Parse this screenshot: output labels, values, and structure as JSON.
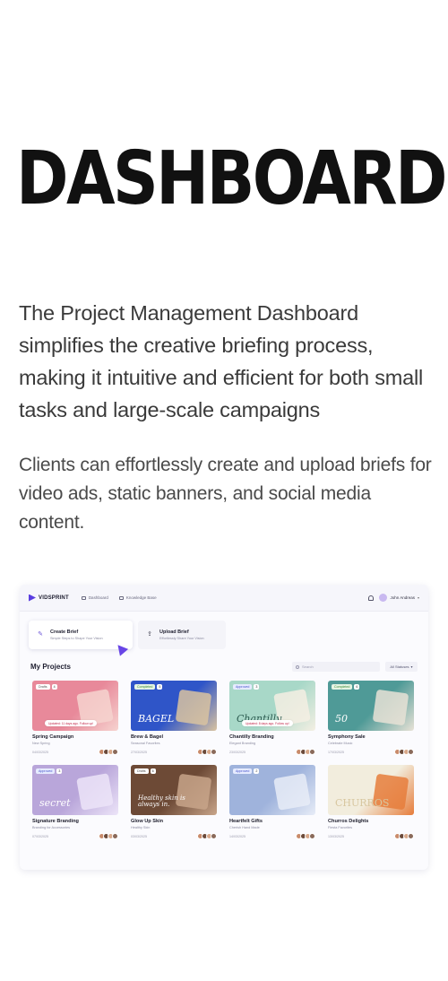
{
  "hero": {
    "title": "DASHBOARD",
    "intro": "The Project Management Dashboard simplifies the creative briefing process, making it intuitive and efficient for both small tasks and large-scale campaigns",
    "sub": "Clients can effortlessly create and upload briefs for video ads, static banners, and social media content."
  },
  "app": {
    "logo": "VIDSPRINT",
    "nav": [
      "Dashboard",
      "Knowledge Base"
    ],
    "user": "John Andreas",
    "brief_cards": [
      {
        "title": "Create Brief",
        "desc": "Simple Steps to Shape Your Vision",
        "icon": "pencil-icon"
      },
      {
        "title": "Upload Brief",
        "desc": "Effortlessly Share Your Vision",
        "icon": "upload-icon"
      }
    ],
    "projects_title": "My Projects",
    "search_placeholder": "Search",
    "status_filter": "All Statuses",
    "projects": [
      {
        "status": "Drafts",
        "count": "4",
        "title": "Spring Campaign",
        "sub": "New Spring",
        "date": "04/03/2025",
        "update": "Updated: 11 days ago. Follow up!",
        "bg": "#e8899a",
        "accent": "#f6d3cf"
      },
      {
        "status": "Completed",
        "count": "5",
        "title": "Brew & Bagel",
        "sub": "Seasonal Favorites",
        "date": "27/03/2025",
        "update": "",
        "bg": "#2f55c8",
        "accent": "#d9c3a0",
        "word": "BAGEL"
      },
      {
        "status": "Approved",
        "count": "3",
        "title": "Chantilly Branding",
        "sub": "Elegant Branding",
        "date": "23/03/2025",
        "update": "Updated: 8 days ago. Follow up!",
        "bg": "#a8d8c8",
        "accent": "#f4efe3",
        "word": "Chantilly"
      },
      {
        "status": "Completed",
        "count": "6",
        "title": "Symphony Sale",
        "sub": "Celebrate Music",
        "date": "17/03/2025",
        "update": "",
        "bg": "#4f9a97",
        "accent": "#e8e2d6",
        "word": "50"
      },
      {
        "status": "Approved",
        "count": "3",
        "title": "Signature Branding",
        "sub": "Branding for Accessories",
        "date": "07/03/2025",
        "update": "",
        "bg": "#b9a6da",
        "accent": "#ece4f8",
        "word": "secret"
      },
      {
        "status": "Drafts",
        "count": "6",
        "title": "Glow Up Skin",
        "sub": "Healthy Skin",
        "date": "03/03/2025",
        "update": "",
        "bg": "#6d4a36",
        "accent": "#c8a58a",
        "word": "Healthy skin is always in."
      },
      {
        "status": "Approved",
        "count": "2",
        "title": "Heartfelt Gifts",
        "sub": "Cherish Hand Made",
        "date": "14/03/2025",
        "update": "",
        "bg": "#9fb3dc",
        "accent": "#e7ecf7"
      },
      {
        "status": "",
        "count": "",
        "title": "Churros Delights",
        "sub": "Fiesta Favorites",
        "date": "13/03/2025",
        "update": "",
        "bg": "#f2eddd",
        "accent": "#e67c3b",
        "word": "CHURROS"
      }
    ],
    "avatar_colors": [
      "#c98b6b",
      "#6b4a3a",
      "#d8a88a",
      "#8a6a5a"
    ]
  }
}
